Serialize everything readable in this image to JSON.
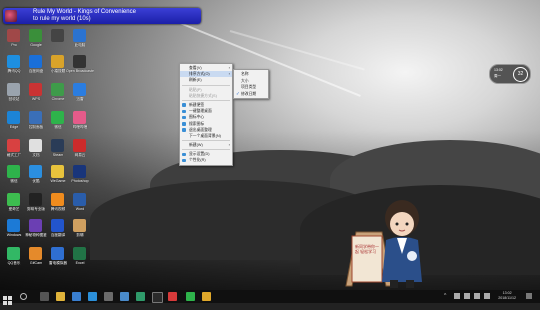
{
  "media_popup": {
    "line1": "Rule My World - Kings of Convenience",
    "line2": "to rule my world (10s)"
  },
  "desktop_icons": [
    {
      "label": "Pro",
      "color": "#a04848"
    },
    {
      "label": "Google",
      "color": "#3a8f3a"
    },
    {
      "label": "",
      "color": "#444444"
    },
    {
      "label": "此电脑",
      "color": "#2b73d1"
    },
    {
      "label": "腾讯QQ",
      "color": "#1e8fe0"
    },
    {
      "label": "百度网盘",
      "color": "#1a6fd8"
    },
    {
      "label": "小猿搜题",
      "color": "#d9a32a"
    },
    {
      "label": "Open Broadcaster",
      "color": "#333333"
    },
    {
      "label": "回收站",
      "color": "#9aa3ad"
    },
    {
      "label": "WPS",
      "color": "#c93333"
    },
    {
      "label": "Chrome",
      "color": "#3e9b4a"
    },
    {
      "label": "迅雷",
      "color": "#2b7de0"
    },
    {
      "label": "Edge",
      "color": "#1c84d6"
    },
    {
      "label": "控制面板",
      "color": "#3a6fb8"
    },
    {
      "label": "微信",
      "color": "#2eb34b"
    },
    {
      "label": "哔哩哔哩",
      "color": "#e55b8a"
    },
    {
      "label": "格式工厂",
      "color": "#d84141"
    },
    {
      "label": "文档",
      "color": "#e0e0e0"
    },
    {
      "label": "Steam",
      "color": "#2a3c57"
    },
    {
      "label": "网易云",
      "color": "#cc2b2b"
    },
    {
      "label": "微信",
      "color": "#2eb34b"
    },
    {
      "label": "优酷",
      "color": "#2b8fe0"
    },
    {
      "label": "WeGame",
      "color": "#e8c33c"
    },
    {
      "label": "Photoshop",
      "color": "#19357a"
    },
    {
      "label": "爱奇艺",
      "color": "#3dbd4f"
    },
    {
      "label": "剪映专业版",
      "color": "#222222"
    },
    {
      "label": "腾讯视频",
      "color": "#f08c1e"
    },
    {
      "label": "Word",
      "color": "#2a5daa"
    },
    {
      "label": "Windows",
      "color": "#1c7ad6"
    },
    {
      "label": "神秘物种图鉴",
      "color": "#6b3fb3"
    },
    {
      "label": "百度翻译",
      "color": "#2255cc"
    },
    {
      "label": "剪辑",
      "color": "#d0a060"
    },
    {
      "label": "QQ音乐",
      "color": "#32b865"
    },
    {
      "label": "GifCam",
      "color": "#e58a2b"
    },
    {
      "label": "雷电模拟器",
      "color": "#2f6fd1"
    },
    {
      "label": "Excel",
      "color": "#217346"
    },
    {
      "label": "Total Control",
      "color": "#1f6ed4"
    },
    {
      "label": "极速PDF",
      "color": "#333333"
    },
    {
      "label": "蓝奏云",
      "color": "#2b7de0"
    },
    {
      "label": "PowerPoint",
      "color": "#c4452b"
    },
    {
      "label": "腾讯会议",
      "color": "#e0822b"
    },
    {
      "label": "Play",
      "color": "#3aa85a"
    },
    {
      "label": "FF浏览器",
      "color": "#e0822b"
    },
    {
      "label": "酷狗",
      "color": "#1f88e0"
    },
    {
      "label": "QQ游戏",
      "color": "#2aa0e0"
    },
    {
      "label": "网易",
      "color": "#cc2b2b"
    },
    {
      "label": "360",
      "color": "#d93636"
    },
    {
      "label": "腾讯QQ",
      "color": "#1e8fe0"
    }
  ],
  "context_menu": {
    "items": [
      {
        "label": "查看(V)",
        "arrow": true,
        "icon": ""
      },
      {
        "label": "排序方式(O)",
        "arrow": true,
        "icon": "",
        "highlight": true
      },
      {
        "label": "刷新(E)",
        "arrow": false,
        "icon": ""
      },
      {
        "sep": true
      },
      {
        "label": "粘贴(P)",
        "arrow": false,
        "icon": "",
        "disabled": true
      },
      {
        "label": "粘贴快捷方式(S)",
        "arrow": false,
        "icon": "",
        "disabled": true
      },
      {
        "sep": true
      },
      {
        "label": "新建便签",
        "arrow": false,
        "icon": "#3a8fd6"
      },
      {
        "label": "一键整理桌面",
        "arrow": false,
        "icon": "#3a8fd6"
      },
      {
        "label": "图标中心",
        "arrow": false,
        "icon": "#3a8fd6"
      },
      {
        "label": "搜索图标",
        "arrow": false,
        "icon": "#3a8fd6"
      },
      {
        "label": "退出桌面整理",
        "arrow": false,
        "icon": "#3a8fd6"
      },
      {
        "label": "下一个桌面背景(N)",
        "arrow": false,
        "icon": ""
      },
      {
        "sep": true
      },
      {
        "label": "新建(W)",
        "arrow": true,
        "icon": ""
      },
      {
        "sep": true
      },
      {
        "label": "显示设置(D)",
        "arrow": false,
        "icon": "#3a8fd6"
      },
      {
        "label": "个性化(R)",
        "arrow": false,
        "icon": "#3a8fd6"
      }
    ]
  },
  "sort_submenu": {
    "items": [
      {
        "label": "名称",
        "checked": false
      },
      {
        "label": "大小",
        "checked": false
      },
      {
        "label": "项目类型",
        "checked": false
      },
      {
        "label": "修改日期",
        "checked": true
      }
    ]
  },
  "clock_widget": {
    "line1": "13:02",
    "line2": "周一",
    "ring": "32"
  },
  "mascot": {
    "sign_text": "新同学带你一起 轻松学习"
  },
  "taskbar": {
    "time": "13:02",
    "date": "2018/11/12"
  }
}
